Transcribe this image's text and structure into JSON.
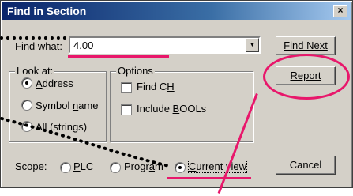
{
  "window": {
    "title": "Find in Section",
    "close_glyph": "×"
  },
  "find": {
    "label_prefix": "Find ",
    "label_accel": "w",
    "label_suffix": "hat:",
    "value": "4.00"
  },
  "buttons": {
    "find_next": "Find Next",
    "report": "Report",
    "cancel": "Cancel"
  },
  "look_at": {
    "title": "Look at:",
    "options": [
      {
        "label": "Address",
        "accel_index": 0,
        "selected": true
      },
      {
        "label": "Symbol name",
        "accel_index": 7,
        "selected": false
      },
      {
        "label": "All (strings)",
        "accel_index": 4,
        "selected": false
      }
    ]
  },
  "options_group": {
    "title": "Options",
    "find_ch": "Find CH",
    "include_bools": "Include BOOLs"
  },
  "scope": {
    "label": "Scope:",
    "options": [
      {
        "label": "PLC",
        "selected": false
      },
      {
        "label": "Program",
        "selected": false
      },
      {
        "label": "Current view",
        "selected": true
      }
    ]
  },
  "colors": {
    "annotation": "#e8176b",
    "titlebar": "#0a246a",
    "face": "#d4d0c8"
  }
}
